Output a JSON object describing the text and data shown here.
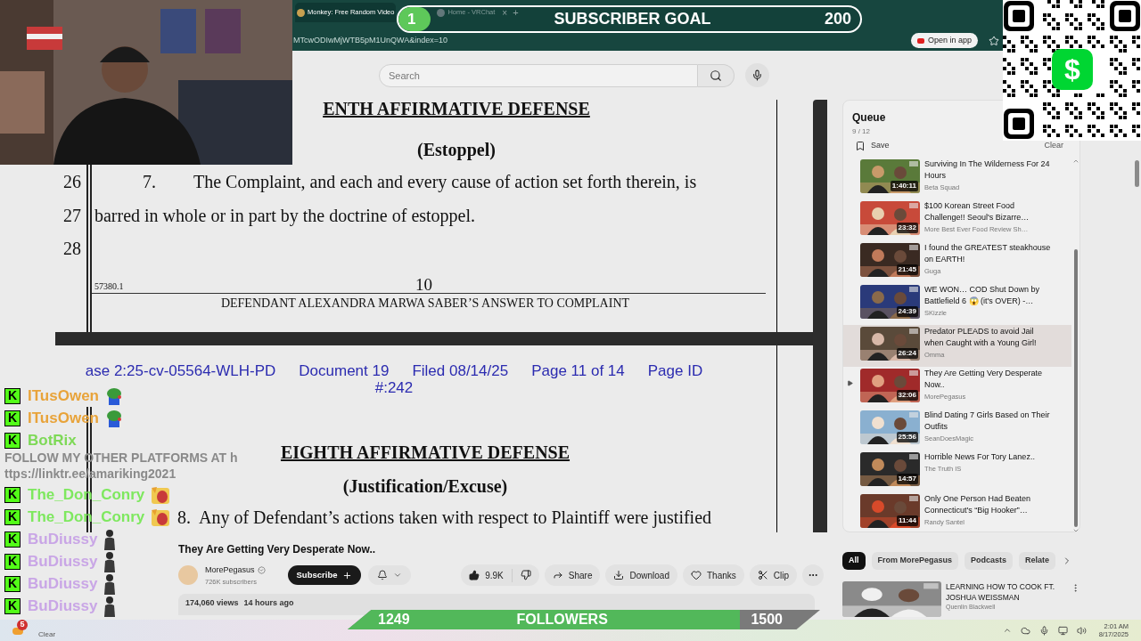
{
  "browser": {
    "tabs": [
      {
        "title": "Monkey: Free Random Video",
        "selected": true
      },
      {
        "title": "Home - VRChat",
        "selected": false
      }
    ],
    "tab_close": "×",
    "new_tab": "+",
    "url": "MTcwODIwMjWTB5pM1UnQWA&index=10",
    "open_in_app": "Open in app"
  },
  "search": {
    "placeholder": "Search"
  },
  "document": {
    "upper_page": {
      "heading": "ENTH AFFIRMATIVE DEFENSE",
      "subheading": "(Estoppel)",
      "lines": [
        {
          "number": "26",
          "paragraph_number": "7.",
          "text": "The Complaint, and each and every cause of action set forth therein, is"
        },
        {
          "number": "27",
          "text": "barred in whole or in part by the doctrine of estoppel."
        },
        {
          "number": "28"
        }
      ],
      "footer_code": "57380.1",
      "page_number": "10",
      "footer_title": "DEFENDANT ALEXANDRA MARWA SABER’S ANSWER TO COMPLAINT"
    },
    "lower_page": {
      "case_header": [
        "ase 2:25-cv-05564-WLH-PD",
        "Document 19",
        "Filed 08/14/25",
        "Page 11 of 14",
        "Page ID",
        "#:242"
      ],
      "heading": "EIGHTH AFFIRMATIVE DEFENSE",
      "subheading": "(Justification/Excuse)",
      "paragraph_number": "8.",
      "text": "Any of Defendant’s actions taken with respect to Plaintiff were justified"
    }
  },
  "queue": {
    "title": "Queue",
    "position": "9 / 12",
    "save": "Save",
    "clear": "Clear",
    "items": [
      {
        "title": "Surviving In The Wilderness For 24 Hours",
        "channel": "Beta Squad",
        "duration": "1:40:11",
        "selected": false,
        "playing": false
      },
      {
        "title": "$100 Korean Street Food Challenge!! Seoul's Bizarre…",
        "channel": "More Best Ever Food Review Sh…",
        "duration": "23:32",
        "selected": false,
        "playing": false
      },
      {
        "title": "I found the GREATEST steakhouse on EARTH!",
        "channel": "Guga",
        "duration": "21:45",
        "selected": false,
        "playing": false
      },
      {
        "title": "WE WON… COD Shut Down by Battlefield 6 😱 (it's OVER) -…",
        "channel": "SKizzle",
        "duration": "24:39",
        "selected": false,
        "playing": false
      },
      {
        "title": "Predator PLEADS to avoid Jail when Caught with a Young Girl!",
        "channel": "Omma",
        "duration": "26:24",
        "selected": true,
        "playing": false
      },
      {
        "title": "They Are Getting Very Desperate Now..",
        "channel": "MorePegasus",
        "duration": "32:06",
        "selected": false,
        "playing": true
      },
      {
        "title": "Blind Dating 7 Girls Based on Their Outfits",
        "channel": "SeanDoesMagic",
        "duration": "25:56",
        "selected": false,
        "playing": false
      },
      {
        "title": "Horrible News For Tory Lanez..",
        "channel": "The Truth IS",
        "duration": "14:57",
        "selected": false,
        "playing": false
      },
      {
        "title": "Only One Person Had Beaten Connecticut's “Big Hooker”…",
        "channel": "Randy Santel",
        "duration": "11:44",
        "selected": false,
        "playing": false
      }
    ]
  },
  "video": {
    "title": "They Are Getting Very Desperate Now..",
    "channel": "MorePegasus",
    "subscribers": "726K subscribers",
    "subscribe": "Subscribe",
    "likes": "9.9K",
    "actions": [
      {
        "kind": "share",
        "label": "Share"
      },
      {
        "kind": "download",
        "label": "Download"
      },
      {
        "kind": "thanks",
        "label": "Thanks"
      },
      {
        "kind": "clip",
        "label": "Clip"
      }
    ],
    "views": "174,060 views",
    "age": "14 hours ago"
  },
  "related": {
    "chips": [
      {
        "label": "All",
        "selected": true
      },
      {
        "label": "From MorePegasus",
        "selected": false
      },
      {
        "label": "Podcasts",
        "selected": false
      },
      {
        "label": "Relate",
        "selected": false
      }
    ],
    "items": [
      {
        "title": "LEARNING HOW TO COOK FT. JOSHUA WEISSMAN",
        "channel": "Quenlin Blackwell"
      }
    ]
  },
  "chat": [
    {
      "kind": "frog",
      "badge": "K",
      "name": "ITusOwen",
      "color": "#e8a33a"
    },
    {
      "kind": "frog",
      "badge": "K",
      "name": "ITusOwen",
      "color": "#e8a33a"
    },
    {
      "kind": "text",
      "badge": "K",
      "name": "BotRix",
      "color": "#7ed957",
      "message": "FOLLOW MY OTHER PLATFORMS AT https://linktr.ee/amariking2021"
    },
    {
      "kind": "cat",
      "badge": "K",
      "name": "The_Don_Conry",
      "color": "#7ee85f"
    },
    {
      "kind": "cat",
      "badge": "K",
      "name": "The_Don_Conry",
      "color": "#7ee85f"
    },
    {
      "kind": "figure",
      "badge": "K",
      "name": "BuDiussy",
      "color": "#c9a6e6"
    },
    {
      "kind": "figure",
      "badge": "K",
      "name": "BuDiussy",
      "color": "#c9a6e6"
    },
    {
      "kind": "figure",
      "badge": "K",
      "name": "BuDiussy",
      "color": "#c9a6e6"
    },
    {
      "kind": "figure",
      "badge": "K",
      "name": "BuDiussy",
      "color": "#c9a6e6"
    }
  ],
  "subscriber_goal": {
    "count": "1",
    "label": "SUBSCRIBER GOAL",
    "target": "200",
    "level": 0.005
  },
  "followers_goal": {
    "current": "1249",
    "label": "FOLLOWERS",
    "target": "1500",
    "level": 0.83
  },
  "qr_badge": "$",
  "taskbar": {
    "weather_badge": "5",
    "weather": "Clear",
    "time": "2:01 AM",
    "date": "8/17/2025"
  }
}
